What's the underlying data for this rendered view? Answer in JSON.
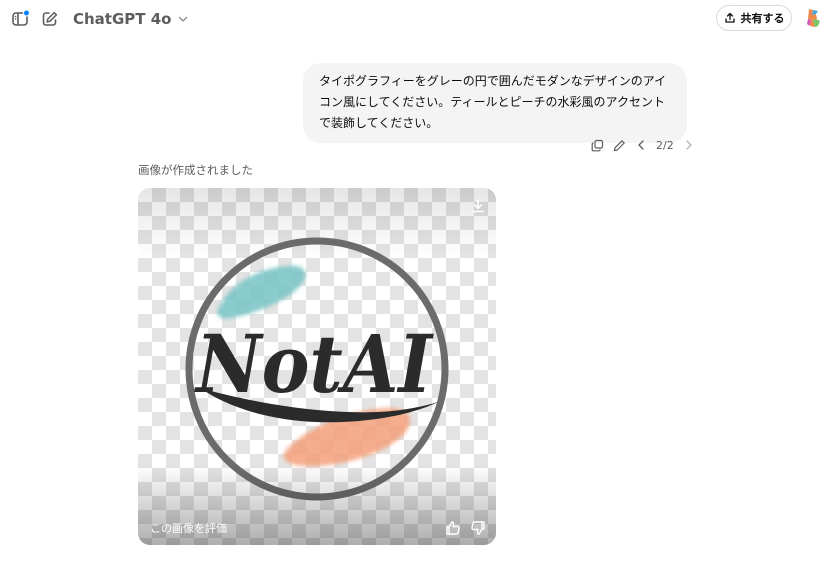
{
  "header": {
    "model_name": "ChatGPT 4o",
    "share_label": "共有する",
    "notification_dot_color": "#0285ff"
  },
  "conversation": {
    "user_message": "タイポグラフィーをグレーの円で囲んだモダンなデザインのアイコン風にしてください。ティールとピーチの水彩風のアクセントで装飾してください。",
    "pager": "2/2",
    "assistant_status": "画像が作成されました",
    "image": {
      "logo_text": "NotAI",
      "rate_label": "この画像を評価",
      "accent_teal": "#7ec6c8",
      "accent_peach": "#f4a07a",
      "ring_color": "#6b6b6b",
      "text_color": "#2b2b2b"
    }
  },
  "icons": {
    "sidebar": "sidebar-toggle-icon",
    "new_chat": "pencil-square-icon",
    "model_chevron": "chevron-down-icon",
    "share": "share-upload-icon",
    "copy": "copy-icon",
    "edit": "pencil-icon",
    "prev": "chevron-left-icon",
    "next": "chevron-right-icon",
    "download": "download-icon",
    "thumbs_up": "thumbs-up-icon",
    "thumbs_down": "thumbs-down-icon"
  }
}
